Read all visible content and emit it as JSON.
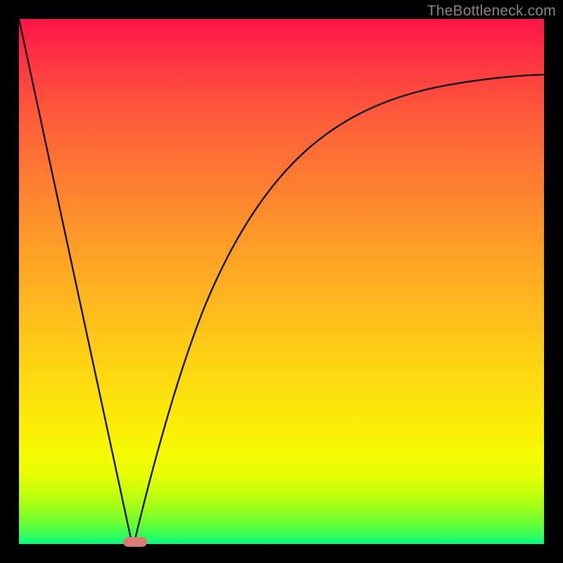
{
  "watermark": "TheBottleneck.com",
  "chart_data": {
    "type": "line",
    "title": "",
    "xlabel": "",
    "ylabel": "",
    "xlim": [
      0,
      100
    ],
    "ylim": [
      0,
      100
    ],
    "grid": false,
    "legend": false,
    "background": {
      "type": "vertical-gradient",
      "stops": [
        {
          "pos": 0,
          "color": "#fd1448"
        },
        {
          "pos": 0.5,
          "color": "#feb81e"
        },
        {
          "pos": 0.83,
          "color": "#f6fa03"
        },
        {
          "pos": 1.0,
          "color": "#06fb86"
        }
      ]
    },
    "series": [
      {
        "name": "left-linear-drop",
        "x": [
          0,
          21.5
        ],
        "y": [
          100,
          0
        ]
      },
      {
        "name": "right-asymptotic-rise",
        "x": [
          21.5,
          25,
          30,
          35,
          40,
          45,
          50,
          55,
          60,
          65,
          70,
          75,
          80,
          85,
          90,
          95,
          100
        ],
        "y": [
          0,
          17,
          37,
          50,
          59,
          66,
          71,
          75,
          78,
          80.5,
          82.5,
          84,
          85.3,
          86.3,
          87.2,
          87.8,
          88.3
        ]
      }
    ],
    "annotations": [
      {
        "name": "minimum-marker",
        "shape": "rounded-rect",
        "x": 21.5,
        "y": 0,
        "color": "#d97a77"
      }
    ]
  }
}
